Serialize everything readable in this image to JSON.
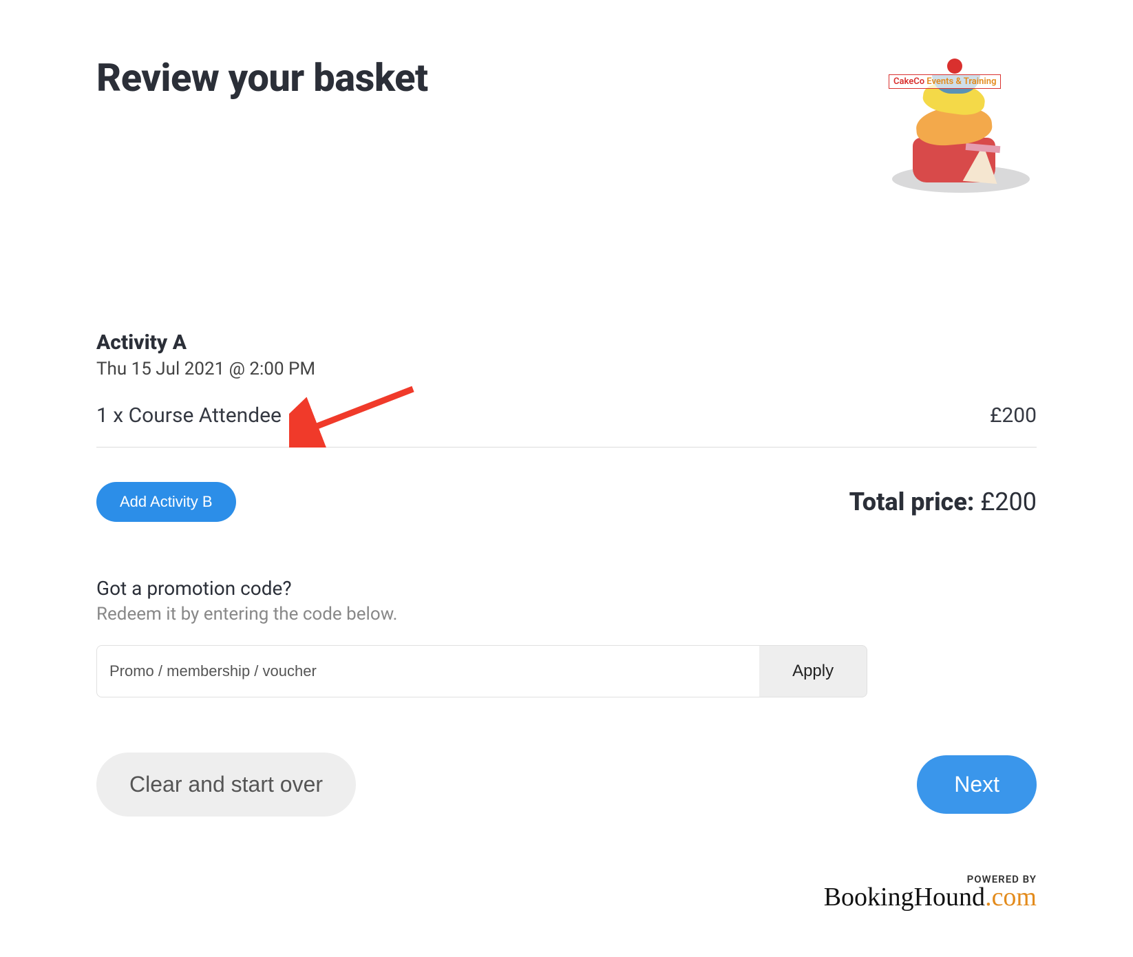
{
  "header": {
    "title": "Review your basket",
    "logo_text": {
      "brand": "CakeCo",
      "rest": " Events & Training"
    }
  },
  "activity": {
    "name": "Activity A",
    "datetime": "Thu 15 Jul 2021 @ 2:00 PM",
    "line_item_desc": "1 x Course Attendee",
    "line_item_price": "£200"
  },
  "add_activity_label": "Add Activity B",
  "total": {
    "label": "Total price:",
    "value": "£200"
  },
  "promo": {
    "heading": "Got a promotion code?",
    "subheading": "Redeem it by entering the code below.",
    "placeholder": "Promo / membership / voucher",
    "apply_label": "Apply"
  },
  "footer": {
    "clear_label": "Clear and start over",
    "next_label": "Next"
  },
  "powered_by": {
    "label": "POWERED BY",
    "brand": "BookingHound",
    "tld": ".com"
  }
}
